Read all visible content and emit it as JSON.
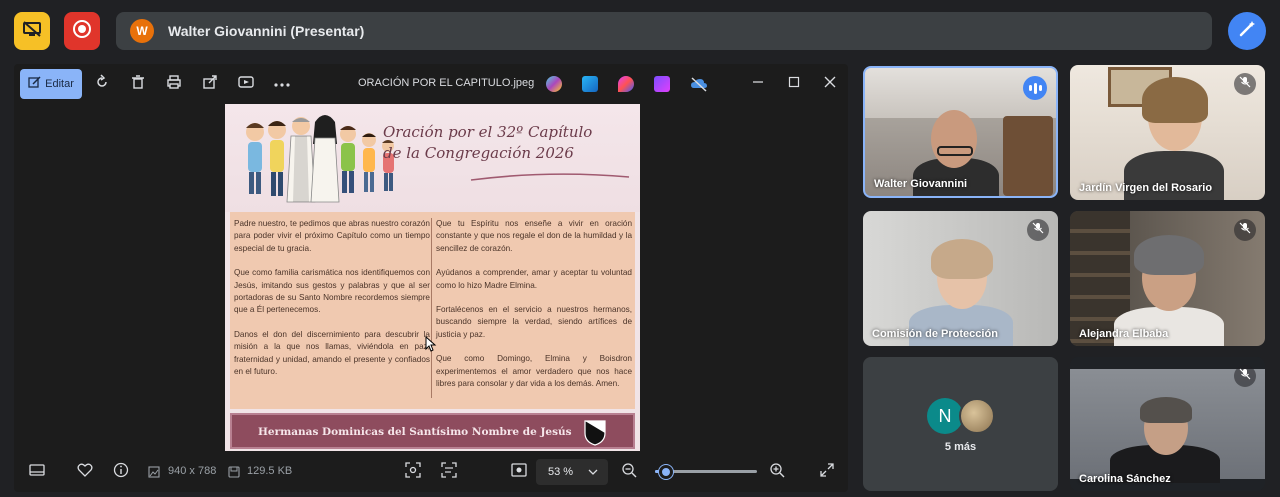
{
  "meeting": {
    "presenter_initial": "W",
    "presenter_label": "Walter Giovannini (Presentar)"
  },
  "viewer": {
    "edit_label": "Editar",
    "filename": "ORACIÓN POR EL CAPITULO.jpeg",
    "image_info": {
      "dimensions": "940 x 788",
      "size": "129.5 KB"
    },
    "zoom": {
      "label": "53 %",
      "slider_fraction": 0.11
    }
  },
  "document": {
    "title_line1": "Oración por el 32º Capítulo",
    "title_line2": "de la Congregación 2026",
    "left_paragraphs": [
      "Padre nuestro, te pedimos que abras nuestro corazón para poder vivir el próximo Capítulo como un tiempo especial de tu gracia.",
      "Que como familia carismática nos identifiquemos con Jesús, imitando sus gestos y palabras y que al ser portadoras de su Santo Nombre recordemos siempre que a Él pertenecemos.",
      "Danos el don del discernimiento para descubrir la misión a la que nos llamas, viviéndola en paz, fraternidad y unidad, amando el presente y confiados en el futuro."
    ],
    "right_paragraphs": [
      "Que tu Espíritu nos enseñe a vivir en oración constante y que nos regale el don de la humildad y la sencillez de corazón.",
      "Ayúdanos a comprender, amar y aceptar tu voluntad como lo hizo Madre Elmina.",
      "Fortalécenos en el servicio a nuestros hermanos, buscando siempre la verdad, siendo artífices de justicia y paz.",
      "Que como Domingo, Elmina y Boisdron experimentemos el amor verdadero que nos hace libres para consolar y dar vida a los demás. Amen."
    ],
    "footer": "Hermanas Dominicas del Santísimo Nombre de Jesús"
  },
  "participants": [
    {
      "name": "Walter Giovannini",
      "state": "speaking"
    },
    {
      "name": "Jardín Virgen del Rosario",
      "state": "muted"
    },
    {
      "name": "Comisión de Protección",
      "state": "muted"
    },
    {
      "name": "Alejandra Elbaba",
      "state": "muted"
    },
    {
      "name": "Carolina Sánchez",
      "state": "muted"
    }
  ],
  "more_participants": {
    "avatar_initial": "N",
    "label": "5 más"
  },
  "colors": {
    "present_button": "#f6c026",
    "record_button": "#e0352b",
    "accent_blue": "#4285f4",
    "edit_button": "#8ab4f8",
    "doc_footer": "#8e4c5e"
  },
  "icons": [
    "present-stop-icon",
    "record-icon",
    "magic-pen-icon",
    "edit-icon",
    "rotate-icon",
    "trash-icon",
    "print-icon",
    "share-icon",
    "slideshow-icon",
    "more-icon",
    "minimize-icon",
    "maximize-icon",
    "close-icon",
    "filmstrip-icon",
    "heart-icon",
    "info-icon",
    "fit-icon",
    "actual-size-icon",
    "zoom-out-icon",
    "zoom-in-icon",
    "fullscreen-icon",
    "mic-off-icon"
  ]
}
